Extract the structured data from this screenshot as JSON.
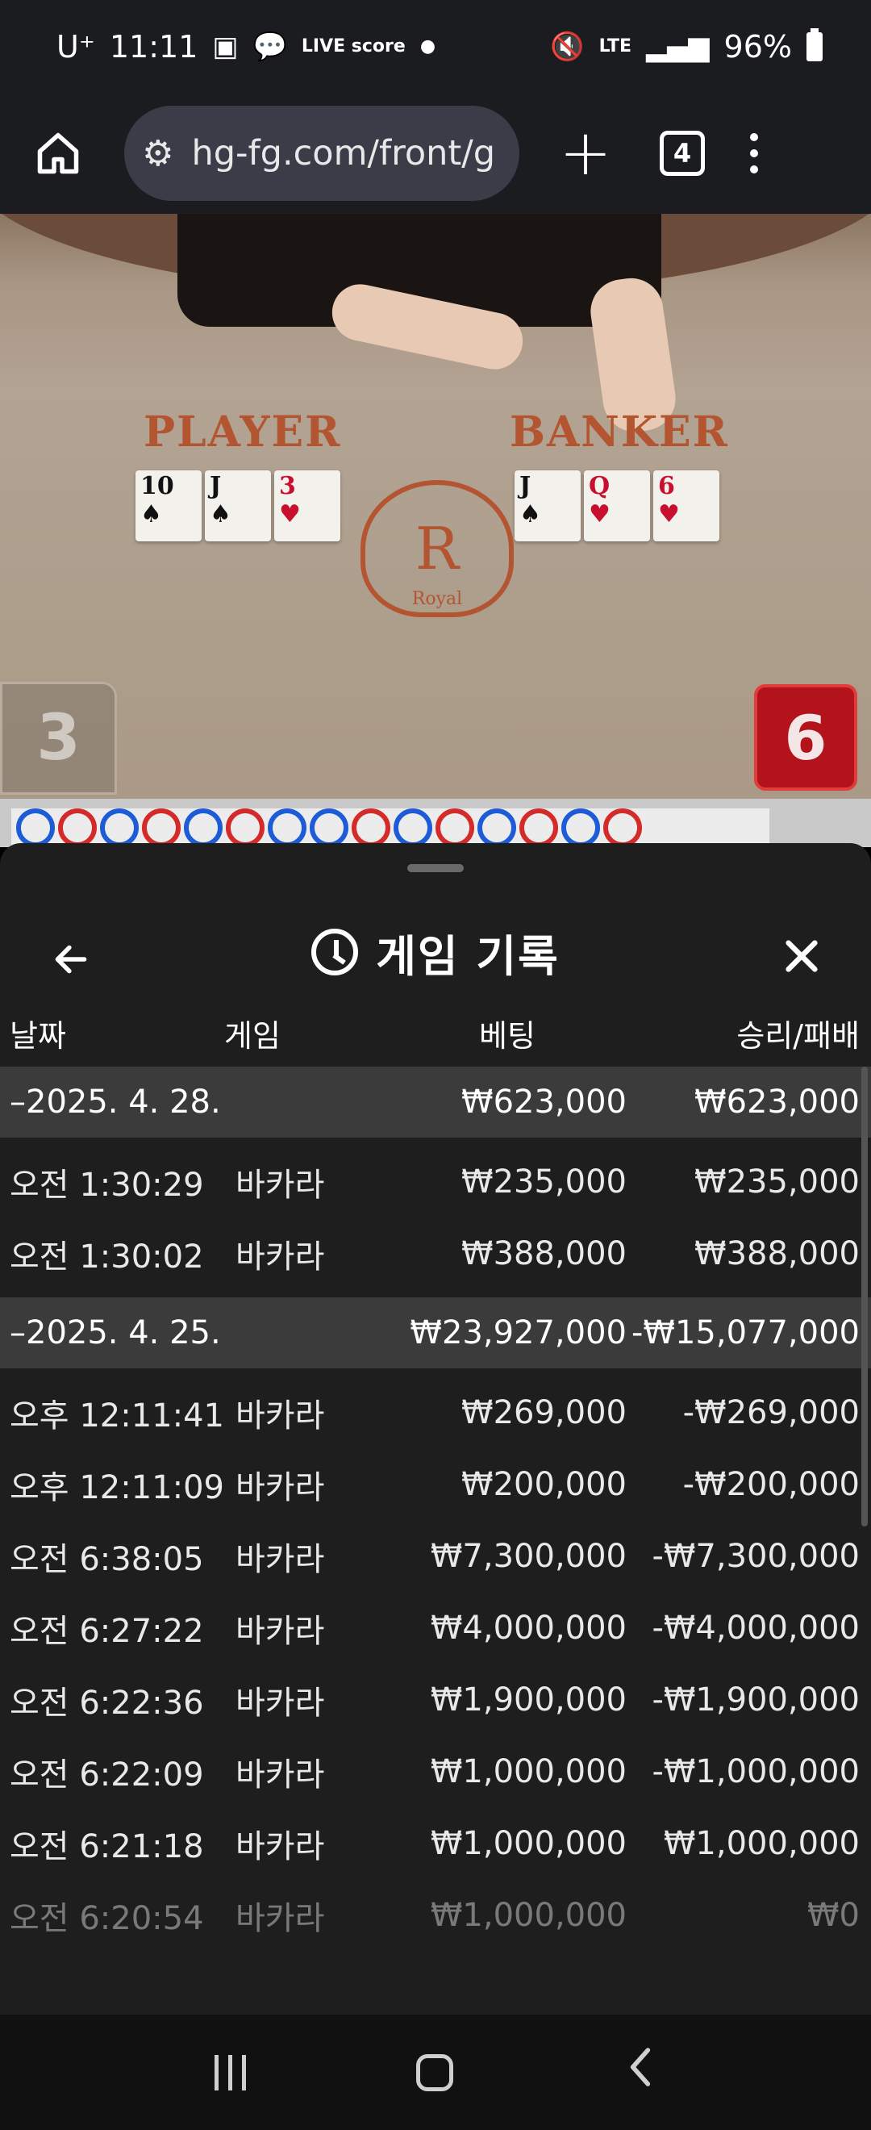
{
  "status_bar": {
    "carrier": "U⁺",
    "time": "11:11",
    "live_badge": "LIVE score",
    "network": "LTE",
    "battery": "96%"
  },
  "browser": {
    "url": "hg-fg.com/front/g",
    "tab_count": "4"
  },
  "game_video": {
    "player_label": "PLAYER",
    "banker_label": "BANKER",
    "player_score": "3",
    "banker_score": "6",
    "player_cards": [
      {
        "rank": "10",
        "suit": "♠",
        "color": "black"
      },
      {
        "rank": "J",
        "suit": "♠",
        "color": "black"
      },
      {
        "rank": "3",
        "suit": "♥",
        "color": "red"
      }
    ],
    "banker_cards": [
      {
        "rank": "J",
        "suit": "♠",
        "color": "black"
      },
      {
        "rank": "Q",
        "suit": "♥",
        "color": "red"
      },
      {
        "rank": "6",
        "suit": "♥",
        "color": "red"
      }
    ],
    "crest_letter": "R",
    "crest_text": "Royal"
  },
  "history": {
    "title": "게임 기록",
    "columns": {
      "date": "날짜",
      "game": "게임",
      "bet": "베팅",
      "result": "승리/패배"
    },
    "groups": [
      {
        "date": "–2025. 4. 28.",
        "bet": "₩623,000",
        "result": "₩623,000",
        "entries": [
          {
            "time": "오전 1:30:29",
            "game": "바카라",
            "bet": "₩235,000",
            "result": "₩235,000"
          },
          {
            "time": "오전 1:30:02",
            "game": "바카라",
            "bet": "₩388,000",
            "result": "₩388,000"
          }
        ]
      },
      {
        "date": "–2025. 4. 25.",
        "bet": "₩23,927,000",
        "result": "-₩15,077,000",
        "entries": [
          {
            "time": "오후 12:11:41",
            "game": "바카라",
            "bet": "₩269,000",
            "result": "-₩269,000"
          },
          {
            "time": "오후 12:11:09",
            "game": "바카라",
            "bet": "₩200,000",
            "result": "-₩200,000"
          },
          {
            "time": "오전 6:38:05",
            "game": "바카라",
            "bet": "₩7,300,000",
            "result": "-₩7,300,000"
          },
          {
            "time": "오전 6:27:22",
            "game": "바카라",
            "bet": "₩4,000,000",
            "result": "-₩4,000,000"
          },
          {
            "time": "오전 6:22:36",
            "game": "바카라",
            "bet": "₩1,900,000",
            "result": "-₩1,900,000"
          },
          {
            "time": "오전 6:22:09",
            "game": "바카라",
            "bet": "₩1,000,000",
            "result": "-₩1,000,000"
          },
          {
            "time": "오전 6:21:18",
            "game": "바카라",
            "bet": "₩1,000,000",
            "result": "₩1,000,000"
          },
          {
            "time": "오전 6:20:54",
            "game": "바카라",
            "bet": "₩1,000,000",
            "result": "₩0"
          }
        ]
      }
    ]
  },
  "colors": {
    "player_blue": "#1d5cd6",
    "banker_red": "#d42a2a",
    "sheet_bg": "#1e1e1e",
    "group_row_bg": "#3b3b3b"
  }
}
